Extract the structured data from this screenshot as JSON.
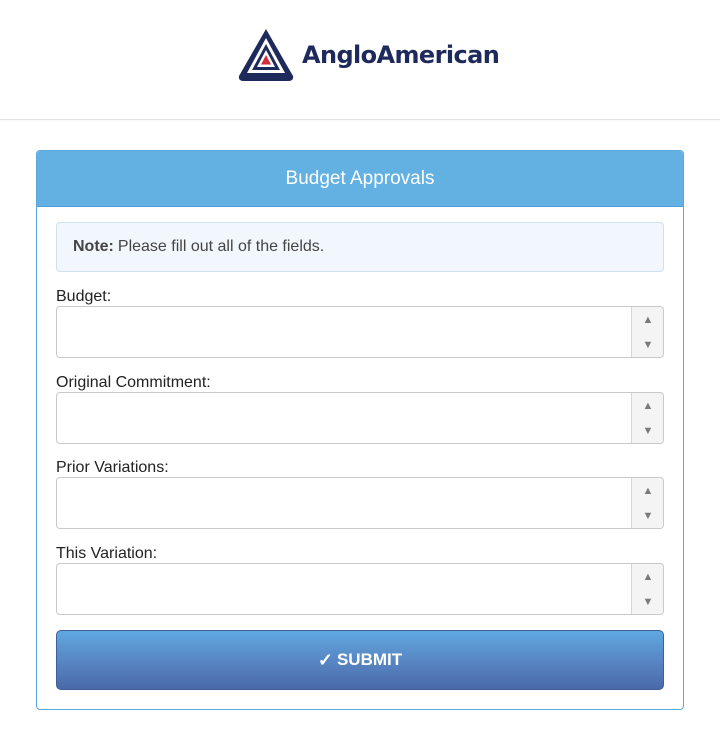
{
  "header": {
    "logo_text": "AngloAmerican"
  },
  "form": {
    "title": "Budget Approvals",
    "note": {
      "label": "Note:",
      "text": "Please fill out all of the fields."
    },
    "fields": [
      {
        "label": "Budget:",
        "value": ""
      },
      {
        "label": "Original Commitment:",
        "value": ""
      },
      {
        "label": "Prior Variations:",
        "value": ""
      },
      {
        "label": "This Variation:",
        "value": ""
      }
    ],
    "spinner": {
      "up": "▲",
      "down": "▼"
    },
    "submit": {
      "icon": "✓",
      "label": "SUBMIT"
    }
  },
  "colors": {
    "header_bar": "#63b0e3",
    "submit_top": "#60a8e0",
    "submit_bottom": "#4a6aa9",
    "logo_text": "#1f2a5c",
    "logo_red": "#d42e3b"
  }
}
